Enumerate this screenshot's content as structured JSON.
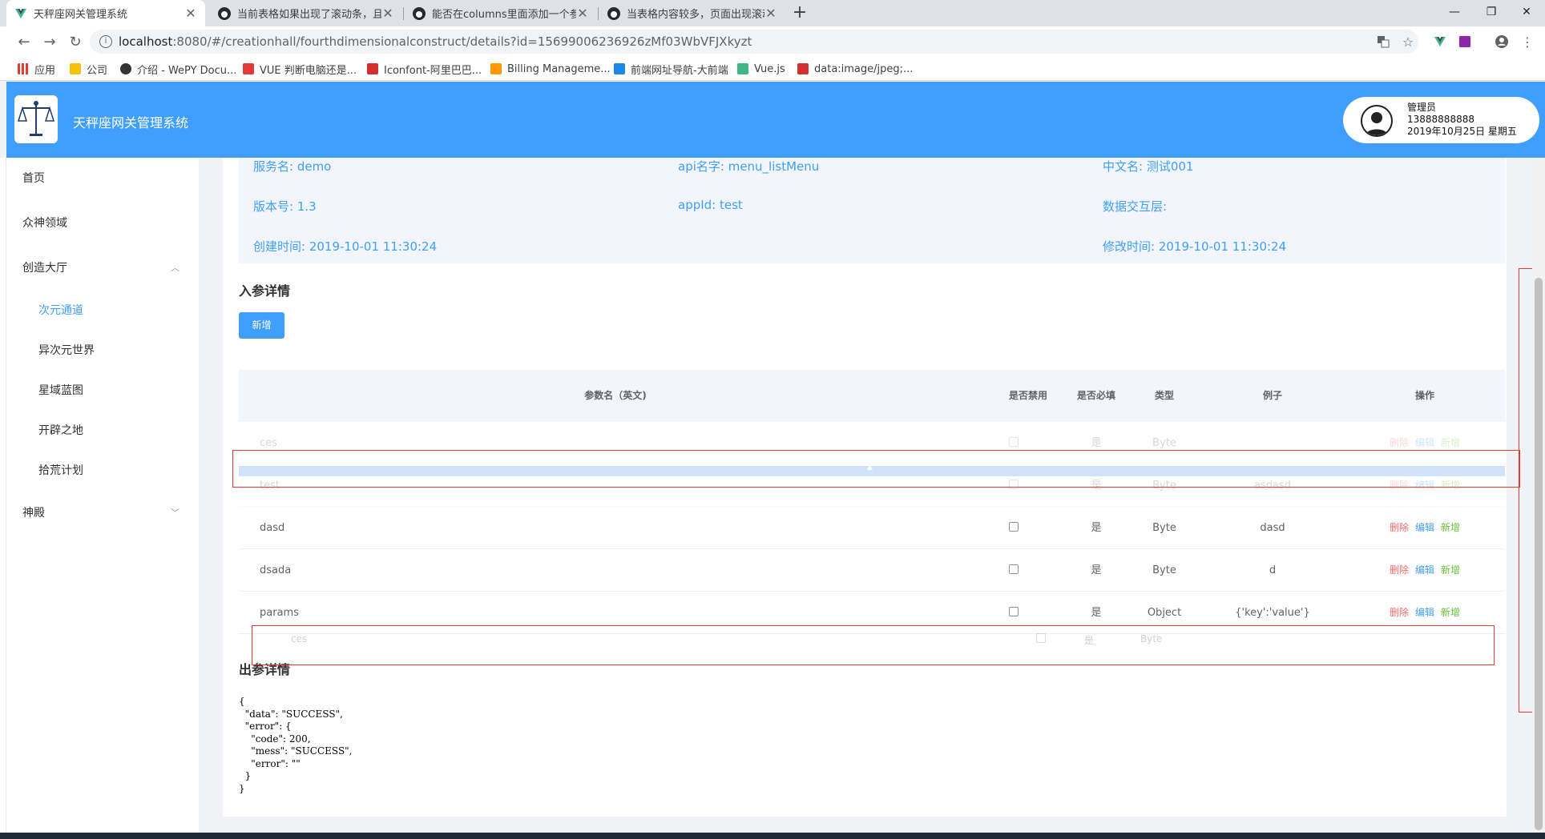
{
  "browser": {
    "tabs": [
      {
        "title": "天秤座网关管理系统",
        "active": true,
        "favicon": "vue-icon"
      },
      {
        "title": "当前表格如果出现了滚动条，且",
        "active": false,
        "favicon": "github-icon"
      },
      {
        "title": "能否在columns里面添加一个参",
        "active": false,
        "favicon": "github-icon"
      },
      {
        "title": "当表格内容较多，页面出现滚动",
        "active": false,
        "favicon": "github-icon"
      }
    ],
    "new_tab": "+",
    "window_controls": {
      "minimize": "—",
      "maximize": "❐",
      "close": "✕"
    },
    "nav": {
      "back": "←",
      "forward": "→",
      "reload": "↻"
    },
    "url_host": "localhost",
    "url_rest": ":8080/#/creationhall/fourthdimensionalconstruct/details?id=15699006236926zMf03WbVFJXkyzt",
    "bookmarks": [
      {
        "label": "应用",
        "color": "#e53935"
      },
      {
        "label": "公司",
        "color": "#f4c20d"
      },
      {
        "label": "介绍 - WePY Docu...",
        "color": "#333333"
      },
      {
        "label": "VUE 判断电脑还是...",
        "color": "#e53935"
      },
      {
        "label": "Iconfont-阿里巴巴...",
        "color": "#d32f2f"
      },
      {
        "label": "Billing Manageme...",
        "color": "#ff9800"
      },
      {
        "label": "前端网址导航-大前端",
        "color": "#1e88e5"
      },
      {
        "label": "Vue.js",
        "color": "#41b883"
      },
      {
        "label": "data:image/jpeg;...",
        "color": "#d32f2f"
      }
    ]
  },
  "header": {
    "app_title": "天秤座网关管理系统",
    "user": {
      "role": "管理员",
      "phone": "13888888888",
      "date": "2019年10月25日 星期五"
    }
  },
  "sidebar": {
    "items": [
      {
        "label": "首页",
        "sub": false
      },
      {
        "label": "众神领域",
        "sub": false
      },
      {
        "label": "创造大厅",
        "sub": false,
        "arrow": "︿"
      },
      {
        "label": "次元通道",
        "sub": true,
        "active": true
      },
      {
        "label": "异次元世界",
        "sub": true
      },
      {
        "label": "星域蓝图",
        "sub": true
      },
      {
        "label": "开辟之地",
        "sub": true
      },
      {
        "label": "拾荒计划",
        "sub": true
      },
      {
        "label": "神殿",
        "sub": false,
        "arrow": "﹀"
      }
    ]
  },
  "details": {
    "service_name": "服务名: demo",
    "api_name": "api名字: menu_listMenu",
    "cn_name": "中文名: 测试001",
    "version": "版本号: 1.3",
    "app_id": "appId: test",
    "data_layer": "数据交互层:",
    "created": "创建时间: 2019-10-01 11:30:24",
    "modified": "修改时间: 2019-10-01 11:30:24"
  },
  "input_params": {
    "title": "入参详情",
    "add_button": "新增",
    "columns": {
      "name": "参数名（英文)",
      "disabled": "是否禁用",
      "required": "是否必填",
      "type": "类型",
      "example": "例子",
      "actions": "操作"
    },
    "rows": [
      {
        "name": "ces",
        "required": "是",
        "type": "Byte",
        "example": "",
        "faded": true
      },
      {
        "name": "test",
        "required": "是",
        "type": "Byte",
        "example": "asdasd",
        "faded": true
      },
      {
        "name": "dasd",
        "required": "是",
        "type": "Byte",
        "example": "dasd",
        "faded": false
      },
      {
        "name": "dsada",
        "required": "是",
        "type": "Byte",
        "example": "d",
        "faded": false
      },
      {
        "name": "params",
        "required": "是",
        "type": "Object",
        "example": "{'key':'value'}",
        "faded": false
      }
    ],
    "ghost_row": {
      "name": "ces",
      "required": "是",
      "type": "Byte"
    },
    "actions": {
      "delete": "删除",
      "edit": "编辑",
      "add": "新增"
    }
  },
  "output_params": {
    "title": "出参详情",
    "json": "{\n  \"data\": \"SUCCESS\",\n  \"error\": {\n    \"code\": 200,\n    \"mess\": \"SUCCESS\",\n    \"error\": \"\"\n  }\n}"
  }
}
